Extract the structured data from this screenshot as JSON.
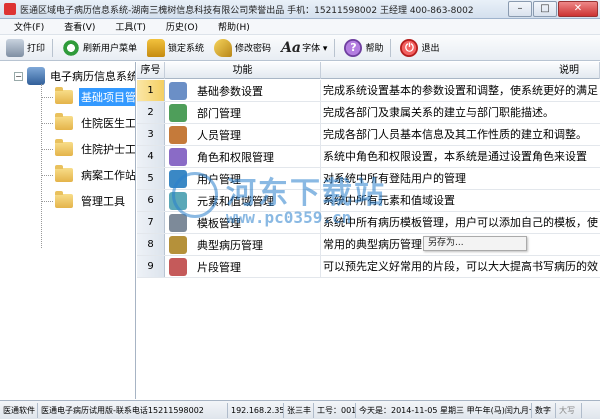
{
  "window": {
    "title": "医通区域电子病历信息系统-湖南三槐树信息科技有限公司荣誉出品 手机：15211598002 王经理 400-863-8002",
    "controls": [
      "–",
      "□",
      "✕"
    ]
  },
  "menu": [
    {
      "label": "文件(F)"
    },
    {
      "label": "查看(V)"
    },
    {
      "label": "工具(T)"
    },
    {
      "label": "历史(O)"
    },
    {
      "label": "帮助(H)"
    }
  ],
  "toolbar": [
    {
      "label": "打印",
      "icon": "printer-icon"
    },
    {
      "label": "刷新用户菜单",
      "icon": "refresh-icon"
    },
    {
      "label": "锁定系统",
      "icon": "lock-icon"
    },
    {
      "label": "修改密码",
      "icon": "key-icon"
    },
    {
      "label": "字体 ▾",
      "icon": "font-icon",
      "glyph": "Aa"
    },
    {
      "label": "帮助",
      "icon": "help-icon",
      "glyph": "?"
    },
    {
      "label": "退出",
      "icon": "exit-icon",
      "glyph": "⏻"
    }
  ],
  "tree": {
    "root": {
      "label": "电子病历信息系统",
      "expander": "−"
    },
    "children": [
      {
        "label": "基础项目管理",
        "selected": true
      },
      {
        "label": "住院医生工作站",
        "selected": false
      },
      {
        "label": "住院护士工作站",
        "selected": false
      },
      {
        "label": "病案工作站",
        "selected": false
      },
      {
        "label": "管理工具",
        "selected": false
      }
    ]
  },
  "grid": {
    "headers": {
      "seq": "序号",
      "func": "功能",
      "desc": "说明"
    },
    "rows": [
      {
        "seq": "1",
        "func": "基础参数设置",
        "desc": "完成系统设置基本的参数设置和调整，使系统更好的满足",
        "icon_color": "#6b8fc6"
      },
      {
        "seq": "2",
        "func": "部门管理",
        "desc": "完成各部门及隶属关系的建立与部门职能描述。",
        "icon_color": "#4e9e5a"
      },
      {
        "seq": "3",
        "func": "人员管理",
        "desc": "完成各部门人员基本信息及其工作性质的建立和调整。",
        "icon_color": "#c57a3a"
      },
      {
        "seq": "4",
        "func": "角色和权限管理",
        "desc": "系统中角色和权限设置，本系统是通过设置角色来设置",
        "icon_color": "#8a6bc6"
      },
      {
        "seq": "5",
        "func": "用户管理",
        "desc": "对系统中所有登陆用户的管理",
        "icon_color": "#3a88c5"
      },
      {
        "seq": "6",
        "func": "元素和值域管理",
        "desc": "系统中所有元素和值域设置",
        "icon_color": "#5aa8b8"
      },
      {
        "seq": "7",
        "func": "模板管理",
        "desc": "系统中所有病历模板管理，用户可以添加自己的模板，使",
        "icon_color": "#7d8a99"
      },
      {
        "seq": "8",
        "func": "典型病历管理",
        "desc": "常用的典型病历管理",
        "icon_color": "#b5913a"
      },
      {
        "seq": "9",
        "func": "片段管理",
        "desc": "可以预先定义好常用的片段，可以大大提高书写病历的效",
        "icon_color": "#c55a5a"
      }
    ]
  },
  "context_menu": {
    "item": "另存为..."
  },
  "watermark": {
    "title": "河东下载站",
    "url": "www.pc0359.cn"
  },
  "status": {
    "software": "医通软件",
    "product": "医通电子病历试用版-联系电话15211598002",
    "ip": "192.168.2.35",
    "user": "张三丰",
    "id": "工号：001",
    "date": "今天是：2014-11-05 星期三 甲午年(马)闰九月十三",
    "numlock": "数字",
    "caps": "大写"
  }
}
